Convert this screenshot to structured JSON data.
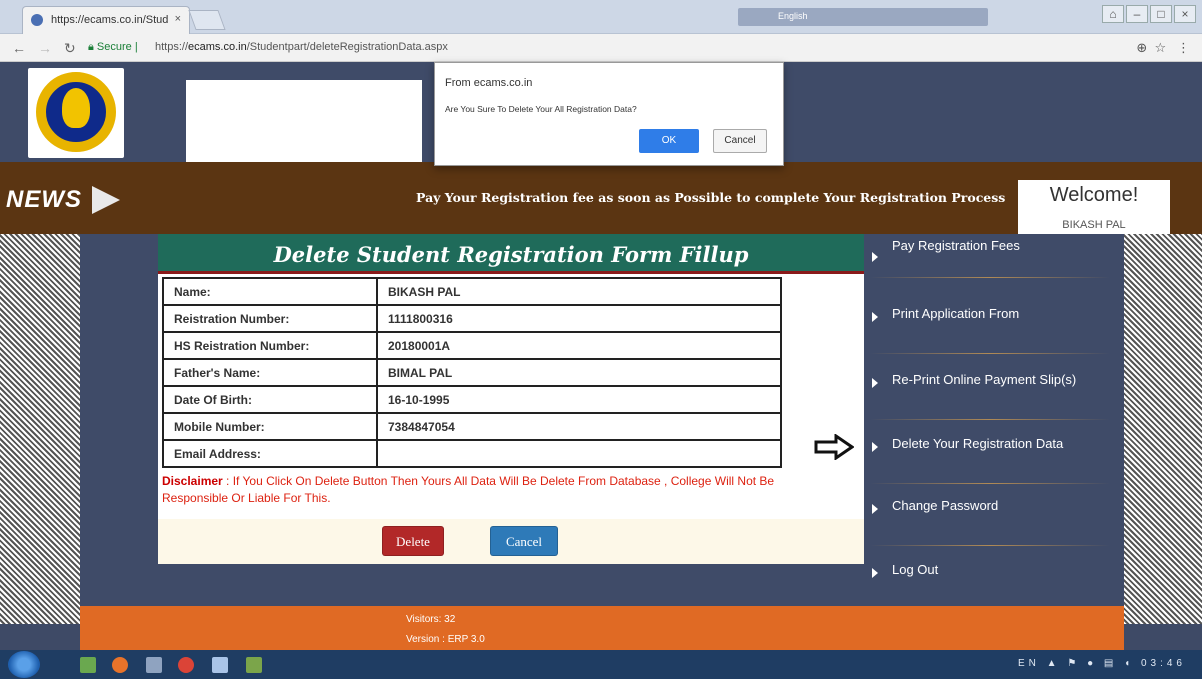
{
  "browser": {
    "tab_title": "https://ecams.co.in/Stud",
    "tab_close": "×",
    "secure_label": "Secure",
    "url_scheme": "https://",
    "url_domain": "ecams.co.in",
    "url_path": "/Studentpart/deleteRegistrationData.aspx",
    "ime_label": "English",
    "zoom_icon": "⊕",
    "star_icon": "☆",
    "menu_icon": "⋮"
  },
  "news": {
    "label": "NEWS",
    "ticker": "Pay Your Registration fee as soon as Possible to complete Your Registration Process"
  },
  "welcome": {
    "title": "Welcome!",
    "user": "BIKASH PAL"
  },
  "form": {
    "title": "Delete Student Registration Form Fillup",
    "rows": [
      {
        "label": "Name:",
        "value": "BIKASH PAL"
      },
      {
        "label": "Reistration Number:",
        "value": "1111800316"
      },
      {
        "label": "HS Reistration Number:",
        "value": "20180001A"
      },
      {
        "label": "Father's Name:",
        "value": "BIMAL PAL"
      },
      {
        "label": "Date Of Birth:",
        "value": "16-10-1995"
      },
      {
        "label": "Mobile Number:",
        "value": "7384847054"
      },
      {
        "label": "Email Address:",
        "value": ""
      }
    ],
    "disclaimer_label": "Disclaimer",
    "disclaimer_text": " : If You Click On Delete Button Then Yours All Data Will Be Delete From Database , College Will Not Be Responsible Or Liable For This.",
    "delete_label": "Delete",
    "cancel_label": "Cancel"
  },
  "menu": {
    "items": [
      {
        "label": "Pay Registration Fees"
      },
      {
        "label": "Print Application From"
      },
      {
        "label": "Re-Print Online Payment Slip(s)"
      },
      {
        "label": "Delete Your Registration Data"
      },
      {
        "label": "Change Password"
      },
      {
        "label": "Log Out"
      }
    ]
  },
  "footer": {
    "visitors": "Visitors: 32",
    "version": "Version : ERP 3.0"
  },
  "dialog": {
    "from": "From ecams.co.in",
    "message": "Are You Sure To Delete Your All Registration Data?",
    "ok_label": "OK",
    "cancel_label": "Cancel"
  },
  "taskbar": {
    "language": "EN",
    "time": "03:46"
  },
  "colors": {
    "header_bg": "#3f4b68",
    "news_bg": "#5b3512",
    "form_title_bg": "#1f6b5a",
    "footer_bg": "#e06a24",
    "delete_btn": "#b22828",
    "cancel_btn": "#2e7ab8"
  }
}
